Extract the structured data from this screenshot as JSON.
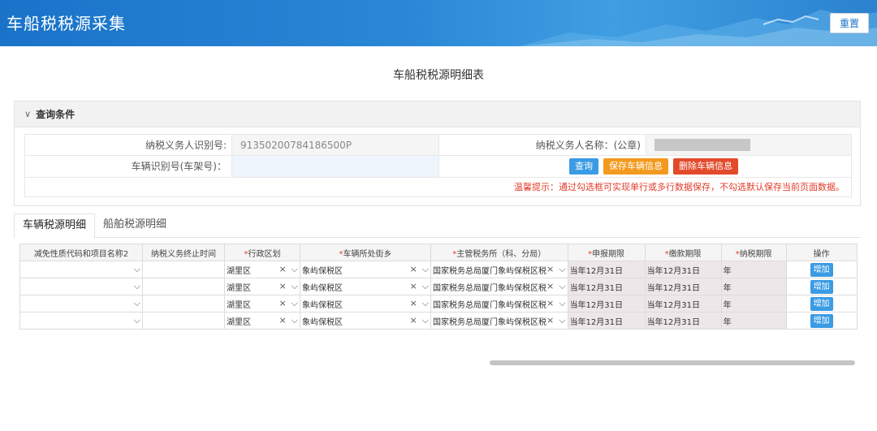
{
  "header": {
    "app_title": "车船税税源采集",
    "reset_label": "重置"
  },
  "page_title": "车船税税源明细表",
  "query": {
    "section_title": "查询条件",
    "taxpayer_id_label": "纳税义务人识别号:",
    "taxpayer_id_value": "91350200784186500P",
    "taxpayer_name_label": "纳税义务人名称：(公章)",
    "vin_label": "车辆识别号(车架号)：",
    "vin_value": "",
    "search_label": "查询",
    "save_label": "保存车辆信息",
    "delete_label": "删除车辆信息",
    "tip": "温馨提示：通过勾选框可实现单行或多行数据保存，不勾选默认保存当前页面数据。"
  },
  "tabs": [
    {
      "label": "车辆税源明细"
    },
    {
      "label": "船舶税源明细"
    }
  ],
  "table": {
    "headers": [
      "减免性质代码和项目名称2",
      "纳税义务终止时间",
      "行政区划",
      "车辆所处街乡",
      "主管税务所（科、分局）",
      "申报期限",
      "缴款期限",
      "纳税期限",
      "操作"
    ],
    "required_mark": "*",
    "rows": [
      {
        "district": "湖里区",
        "street": "象屿保税区",
        "office": "国家税务总局厦门象屿保税区税",
        "declare": "当年12月31日",
        "pay": "当年12月31日",
        "period": "年",
        "action": "增加"
      },
      {
        "district": "湖里区",
        "street": "象屿保税区",
        "office": "国家税务总局厦门象屿保税区税",
        "declare": "当年12月31日",
        "pay": "当年12月31日",
        "period": "年",
        "action": "增加"
      },
      {
        "district": "湖里区",
        "street": "象屿保税区",
        "office": "国家税务总局厦门象屿保税区税",
        "declare": "当年12月31日",
        "pay": "当年12月31日",
        "period": "年",
        "action": "增加"
      },
      {
        "district": "湖里区",
        "street": "象屿保税区",
        "office": "国家税务总局厦门象屿保税区税",
        "declare": "当年12月31日",
        "pay": "当年12月31日",
        "period": "年",
        "action": "增加"
      }
    ],
    "clear_glyph": "×",
    "dropdown_glyph": "⌵"
  },
  "colors": {
    "primary": "#1a73c9",
    "button_blue": "#3b9be4",
    "button_orange": "#f39a1e",
    "button_red": "#e34a2a",
    "warning_text": "#e23c2a"
  }
}
